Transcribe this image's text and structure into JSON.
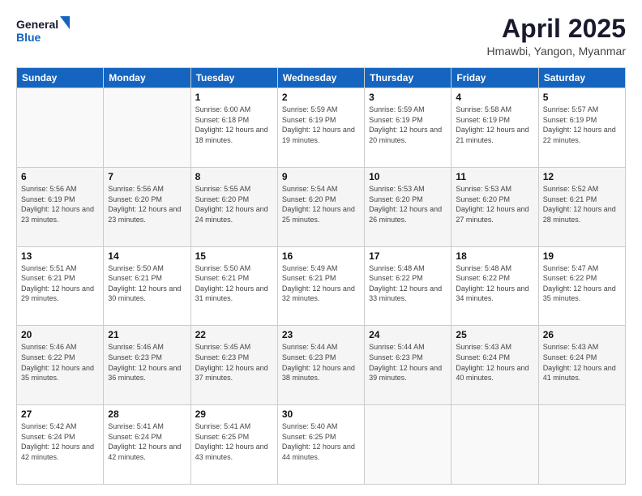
{
  "header": {
    "logo_line1": "General",
    "logo_line2": "Blue",
    "month_title": "April 2025",
    "subtitle": "Hmawbi, Yangon, Myanmar"
  },
  "days_of_week": [
    "Sunday",
    "Monday",
    "Tuesday",
    "Wednesday",
    "Thursday",
    "Friday",
    "Saturday"
  ],
  "weeks": [
    [
      {
        "day": "",
        "info": ""
      },
      {
        "day": "",
        "info": ""
      },
      {
        "day": "1",
        "sunrise": "Sunrise: 6:00 AM",
        "sunset": "Sunset: 6:18 PM",
        "daylight": "Daylight: 12 hours and 18 minutes."
      },
      {
        "day": "2",
        "sunrise": "Sunrise: 5:59 AM",
        "sunset": "Sunset: 6:19 PM",
        "daylight": "Daylight: 12 hours and 19 minutes."
      },
      {
        "day": "3",
        "sunrise": "Sunrise: 5:59 AM",
        "sunset": "Sunset: 6:19 PM",
        "daylight": "Daylight: 12 hours and 20 minutes."
      },
      {
        "day": "4",
        "sunrise": "Sunrise: 5:58 AM",
        "sunset": "Sunset: 6:19 PM",
        "daylight": "Daylight: 12 hours and 21 minutes."
      },
      {
        "day": "5",
        "sunrise": "Sunrise: 5:57 AM",
        "sunset": "Sunset: 6:19 PM",
        "daylight": "Daylight: 12 hours and 22 minutes."
      }
    ],
    [
      {
        "day": "6",
        "sunrise": "Sunrise: 5:56 AM",
        "sunset": "Sunset: 6:19 PM",
        "daylight": "Daylight: 12 hours and 23 minutes."
      },
      {
        "day": "7",
        "sunrise": "Sunrise: 5:56 AM",
        "sunset": "Sunset: 6:20 PM",
        "daylight": "Daylight: 12 hours and 23 minutes."
      },
      {
        "day": "8",
        "sunrise": "Sunrise: 5:55 AM",
        "sunset": "Sunset: 6:20 PM",
        "daylight": "Daylight: 12 hours and 24 minutes."
      },
      {
        "day": "9",
        "sunrise": "Sunrise: 5:54 AM",
        "sunset": "Sunset: 6:20 PM",
        "daylight": "Daylight: 12 hours and 25 minutes."
      },
      {
        "day": "10",
        "sunrise": "Sunrise: 5:53 AM",
        "sunset": "Sunset: 6:20 PM",
        "daylight": "Daylight: 12 hours and 26 minutes."
      },
      {
        "day": "11",
        "sunrise": "Sunrise: 5:53 AM",
        "sunset": "Sunset: 6:20 PM",
        "daylight": "Daylight: 12 hours and 27 minutes."
      },
      {
        "day": "12",
        "sunrise": "Sunrise: 5:52 AM",
        "sunset": "Sunset: 6:21 PM",
        "daylight": "Daylight: 12 hours and 28 minutes."
      }
    ],
    [
      {
        "day": "13",
        "sunrise": "Sunrise: 5:51 AM",
        "sunset": "Sunset: 6:21 PM",
        "daylight": "Daylight: 12 hours and 29 minutes."
      },
      {
        "day": "14",
        "sunrise": "Sunrise: 5:50 AM",
        "sunset": "Sunset: 6:21 PM",
        "daylight": "Daylight: 12 hours and 30 minutes."
      },
      {
        "day": "15",
        "sunrise": "Sunrise: 5:50 AM",
        "sunset": "Sunset: 6:21 PM",
        "daylight": "Daylight: 12 hours and 31 minutes."
      },
      {
        "day": "16",
        "sunrise": "Sunrise: 5:49 AM",
        "sunset": "Sunset: 6:21 PM",
        "daylight": "Daylight: 12 hours and 32 minutes."
      },
      {
        "day": "17",
        "sunrise": "Sunrise: 5:48 AM",
        "sunset": "Sunset: 6:22 PM",
        "daylight": "Daylight: 12 hours and 33 minutes."
      },
      {
        "day": "18",
        "sunrise": "Sunrise: 5:48 AM",
        "sunset": "Sunset: 6:22 PM",
        "daylight": "Daylight: 12 hours and 34 minutes."
      },
      {
        "day": "19",
        "sunrise": "Sunrise: 5:47 AM",
        "sunset": "Sunset: 6:22 PM",
        "daylight": "Daylight: 12 hours and 35 minutes."
      }
    ],
    [
      {
        "day": "20",
        "sunrise": "Sunrise: 5:46 AM",
        "sunset": "Sunset: 6:22 PM",
        "daylight": "Daylight: 12 hours and 35 minutes."
      },
      {
        "day": "21",
        "sunrise": "Sunrise: 5:46 AM",
        "sunset": "Sunset: 6:23 PM",
        "daylight": "Daylight: 12 hours and 36 minutes."
      },
      {
        "day": "22",
        "sunrise": "Sunrise: 5:45 AM",
        "sunset": "Sunset: 6:23 PM",
        "daylight": "Daylight: 12 hours and 37 minutes."
      },
      {
        "day": "23",
        "sunrise": "Sunrise: 5:44 AM",
        "sunset": "Sunset: 6:23 PM",
        "daylight": "Daylight: 12 hours and 38 minutes."
      },
      {
        "day": "24",
        "sunrise": "Sunrise: 5:44 AM",
        "sunset": "Sunset: 6:23 PM",
        "daylight": "Daylight: 12 hours and 39 minutes."
      },
      {
        "day": "25",
        "sunrise": "Sunrise: 5:43 AM",
        "sunset": "Sunset: 6:24 PM",
        "daylight": "Daylight: 12 hours and 40 minutes."
      },
      {
        "day": "26",
        "sunrise": "Sunrise: 5:43 AM",
        "sunset": "Sunset: 6:24 PM",
        "daylight": "Daylight: 12 hours and 41 minutes."
      }
    ],
    [
      {
        "day": "27",
        "sunrise": "Sunrise: 5:42 AM",
        "sunset": "Sunset: 6:24 PM",
        "daylight": "Daylight: 12 hours and 42 minutes."
      },
      {
        "day": "28",
        "sunrise": "Sunrise: 5:41 AM",
        "sunset": "Sunset: 6:24 PM",
        "daylight": "Daylight: 12 hours and 42 minutes."
      },
      {
        "day": "29",
        "sunrise": "Sunrise: 5:41 AM",
        "sunset": "Sunset: 6:25 PM",
        "daylight": "Daylight: 12 hours and 43 minutes."
      },
      {
        "day": "30",
        "sunrise": "Sunrise: 5:40 AM",
        "sunset": "Sunset: 6:25 PM",
        "daylight": "Daylight: 12 hours and 44 minutes."
      },
      {
        "day": "",
        "info": ""
      },
      {
        "day": "",
        "info": ""
      },
      {
        "day": "",
        "info": ""
      }
    ]
  ]
}
